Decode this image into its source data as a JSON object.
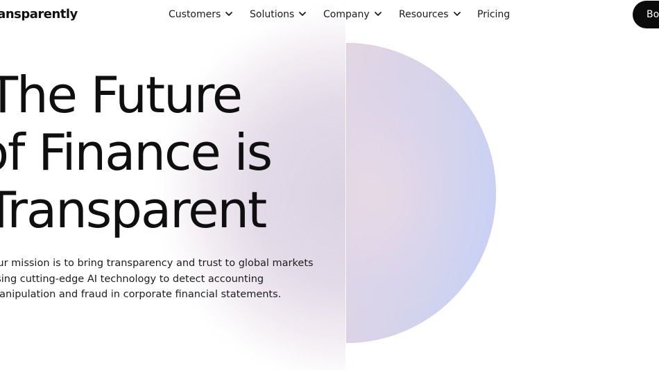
{
  "brand": {
    "name": "Transparently"
  },
  "nav": {
    "items": [
      {
        "label": "Customers",
        "has_dropdown": true
      },
      {
        "label": "Solutions",
        "has_dropdown": true
      },
      {
        "label": "Company",
        "has_dropdown": true
      },
      {
        "label": "Resources",
        "has_dropdown": true
      },
      {
        "label": "Pricing",
        "has_dropdown": false
      }
    ],
    "cta_label": "Book a Demo"
  },
  "hero": {
    "title_lines": [
      "The Future",
      "of Finance is",
      "Transparent"
    ],
    "text_lines": [
      "Our mission is to bring transparency and trust to global markets",
      "using cutting-edge AI technology to detect accounting",
      "manipulation and fraud in corporate financial statements."
    ]
  },
  "colors": {
    "text": "#0f0f0f",
    "cta_background": "#0b0b0b",
    "cta_text": "#ffffff",
    "disc_left": "#e3d6e2",
    "disc_right": "#c4cdf7"
  }
}
